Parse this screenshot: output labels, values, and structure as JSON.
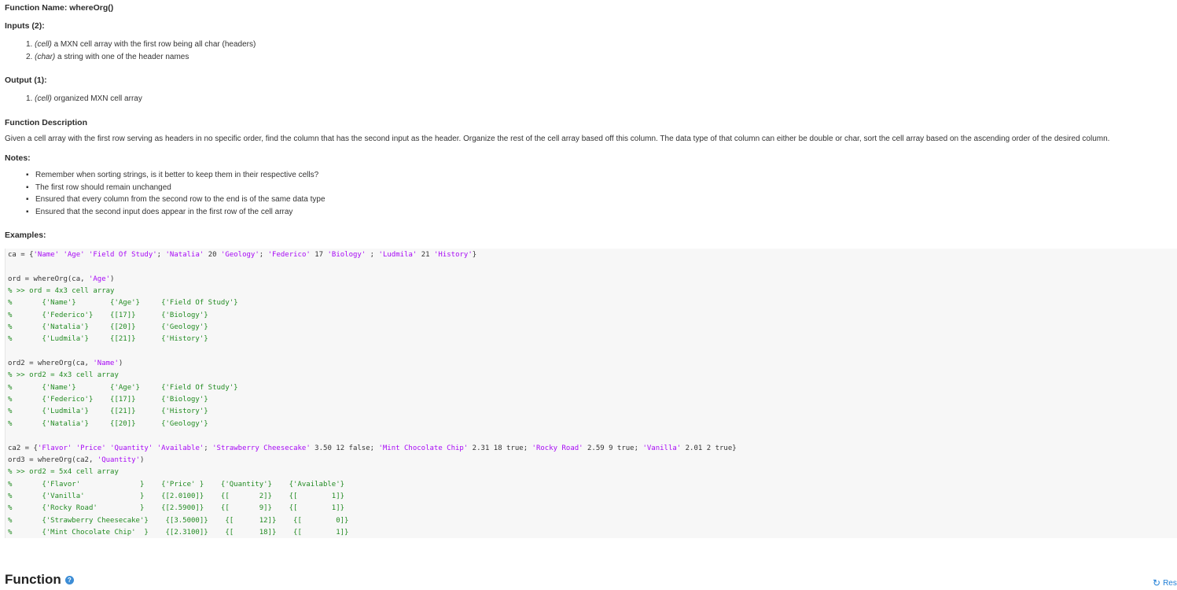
{
  "function_name_label": "Function Name: whereOrg()",
  "inputs": {
    "heading": "Inputs (2):",
    "items": [
      {
        "num": "1.",
        "type": "(cell)",
        "desc": "a MXN cell array with the first row being all char (headers)"
      },
      {
        "num": "2.",
        "type": "(char)",
        "desc": "a string with one of the header names"
      }
    ]
  },
  "output": {
    "heading": "Output (1):",
    "items": [
      {
        "num": "1.",
        "type": "(cell)",
        "desc": "organized MXN cell array"
      }
    ]
  },
  "description": {
    "heading": "Function Description",
    "text": "Given a cell array with the first row serving as headers in no specific order, find the column that has the second input as the header. Organize the rest of the cell array based off this column. The data type of that column can either be double or char, sort the cell array based on the ascending order of the desired column."
  },
  "notes": {
    "heading": "Notes:",
    "items": [
      "Remember when sorting strings, is it better to keep them in their respective cells?",
      "The first row should remain unchanged",
      "Ensured that every column from the second row to the end is of the same data type",
      "Ensured that the second input does appear in the first row of the cell array"
    ]
  },
  "examples": {
    "heading": "Examples:",
    "code_lines": [
      [
        {
          "t": "ca = {"
        },
        {
          "t": "'Name'",
          "c": "str"
        },
        {
          "t": " "
        },
        {
          "t": "'Age'",
          "c": "str"
        },
        {
          "t": " "
        },
        {
          "t": "'Field Of Study'",
          "c": "str"
        },
        {
          "t": "; "
        },
        {
          "t": "'Natalia'",
          "c": "str"
        },
        {
          "t": " 20 "
        },
        {
          "t": "'Geology'",
          "c": "str"
        },
        {
          "t": "; "
        },
        {
          "t": "'Federico'",
          "c": "str"
        },
        {
          "t": " 17 "
        },
        {
          "t": "'Biology'",
          "c": "str"
        },
        {
          "t": " ; "
        },
        {
          "t": "'Ludmila'",
          "c": "str"
        },
        {
          "t": " 21 "
        },
        {
          "t": "'History'",
          "c": "str"
        },
        {
          "t": "}"
        }
      ],
      [],
      [
        {
          "t": "ord = whereOrg(ca, "
        },
        {
          "t": "'Age'",
          "c": "str"
        },
        {
          "t": ")"
        }
      ],
      [
        {
          "t": "% >> ord = 4x3 cell array",
          "c": "cmt"
        }
      ],
      [
        {
          "t": "%       {'Name'}        {'Age'}     {'Field Of Study'}",
          "c": "cmt"
        }
      ],
      [
        {
          "t": "%       {'Federico'}    {[17]}      {'Biology'}",
          "c": "cmt"
        }
      ],
      [
        {
          "t": "%       {'Natalia'}     {[20]}      {'Geology'}",
          "c": "cmt"
        }
      ],
      [
        {
          "t": "%       {'Ludmila'}     {[21]}      {'History'}",
          "c": "cmt"
        }
      ],
      [],
      [
        {
          "t": "ord2 = whereOrg(ca, "
        },
        {
          "t": "'Name'",
          "c": "str"
        },
        {
          "t": ")"
        }
      ],
      [
        {
          "t": "% >> ord2 = 4x3 cell array",
          "c": "cmt"
        }
      ],
      [
        {
          "t": "%       {'Name'}        {'Age'}     {'Field Of Study'}",
          "c": "cmt"
        }
      ],
      [
        {
          "t": "%       {'Federico'}    {[17]}      {'Biology'}",
          "c": "cmt"
        }
      ],
      [
        {
          "t": "%       {'Ludmila'}     {[21]}      {'History'}",
          "c": "cmt"
        }
      ],
      [
        {
          "t": "%       {'Natalia'}     {[20]}      {'Geology'}",
          "c": "cmt"
        }
      ],
      [],
      [
        {
          "t": "ca2 = {"
        },
        {
          "t": "'Flavor'",
          "c": "str"
        },
        {
          "t": " "
        },
        {
          "t": "'Price'",
          "c": "str"
        },
        {
          "t": " "
        },
        {
          "t": "'Quantity'",
          "c": "str"
        },
        {
          "t": " "
        },
        {
          "t": "'Available'",
          "c": "str"
        },
        {
          "t": "; "
        },
        {
          "t": "'Strawberry Cheesecake'",
          "c": "str"
        },
        {
          "t": " 3.50 12 false; "
        },
        {
          "t": "'Mint Chocolate Chip'",
          "c": "str"
        },
        {
          "t": " 2.31 18 true; "
        },
        {
          "t": "'Rocky Road'",
          "c": "str"
        },
        {
          "t": " 2.59 9 true; "
        },
        {
          "t": "'Vanilla'",
          "c": "str"
        },
        {
          "t": " 2.01 2 true}"
        }
      ],
      [
        {
          "t": "ord3 = whereOrg(ca2, "
        },
        {
          "t": "'Quantity'",
          "c": "str"
        },
        {
          "t": ")"
        }
      ],
      [
        {
          "t": "% >> ord2 = 5x4 cell array",
          "c": "cmt"
        }
      ],
      [
        {
          "t": "%       {'Flavor'              }    {'Price' }    {'Quantity'}    {'Available'}",
          "c": "cmt"
        }
      ],
      [
        {
          "t": "%       {'Vanilla'             }    {[2.0100]}    {[       2]}    {[        1]}",
          "c": "cmt"
        }
      ],
      [
        {
          "t": "%       {'Rocky Road'          }    {[2.5900]}    {[       9]}    {[        1]}",
          "c": "cmt"
        }
      ],
      [
        {
          "t": "%       {'Strawberry Cheesecake'}    {[3.5000]}    {[      12]}    {[        0]}",
          "c": "cmt"
        }
      ],
      [
        {
          "t": "%       {'Mint Chocolate Chip'  }    {[2.3100]}    {[      18]}    {[        1]}",
          "c": "cmt"
        }
      ]
    ]
  },
  "footer": {
    "title": "Function",
    "help_icon": "question-circle-icon",
    "reset_label": "Res",
    "reset_icon": "refresh-icon"
  },
  "colors": {
    "string": "#a709f5",
    "comment": "#228b22",
    "link": "#1f7ed6"
  }
}
